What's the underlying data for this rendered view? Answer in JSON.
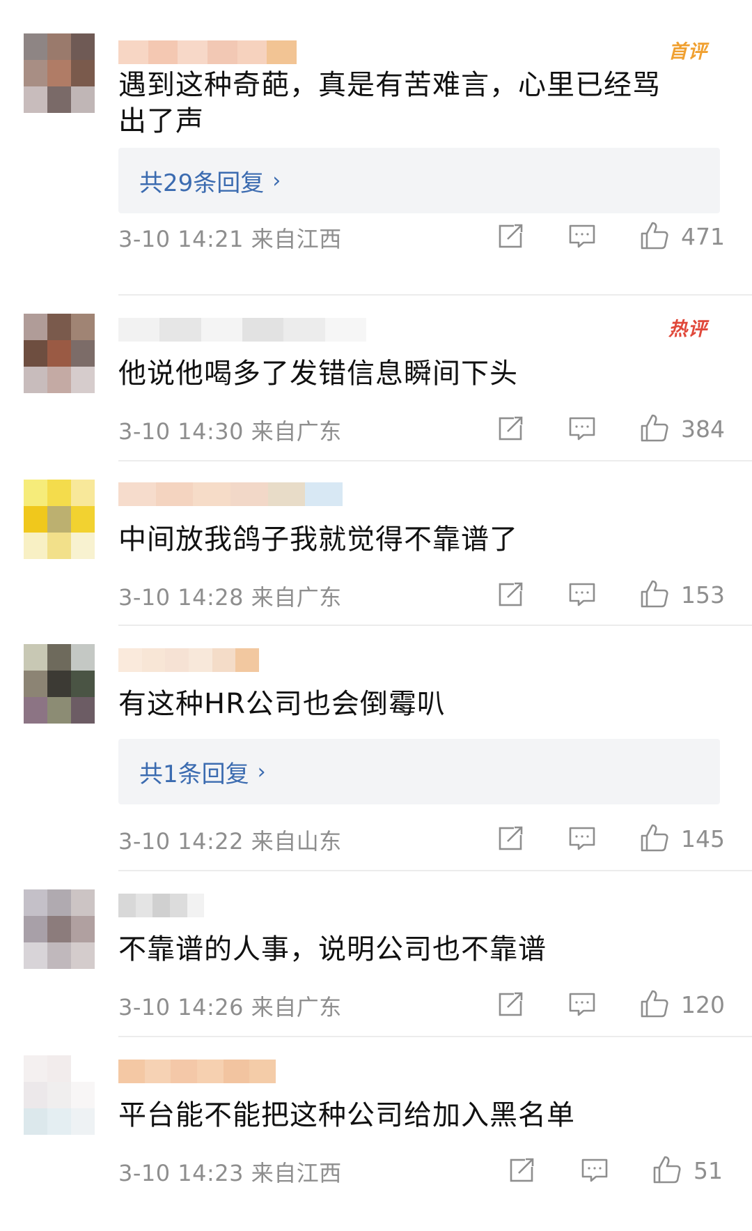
{
  "comments": [
    {
      "avatar_colors": [
        "#8e8584",
        "#9a7a6c",
        "#6f5a55",
        "#a88e84",
        "#b07c66",
        "#7a5a4c",
        "#c8bcbc",
        "#7a6a68",
        "#c0b6b6"
      ],
      "name_colors": [
        "#f7d6c4",
        "#f4c8b2",
        "#f7d8c8",
        "#f2c8b4",
        "#f6d2be",
        "#f2c494"
      ],
      "badge": "首评",
      "badge_type": "first",
      "text": "遇到这种奇葩，真是有苦难言，心里已经骂出了声",
      "reply_label": "共29条回复",
      "meta": "3-10 14:21  来自江西",
      "likes": "471"
    },
    {
      "avatar_colors": [
        "#b09c98",
        "#7a5a4c",
        "#a08474",
        "#6e4e40",
        "#9a5a44",
        "#7c6c68",
        "#c8bcbc",
        "#c4aaa4",
        "#d6cccc"
      ],
      "name_colors": [
        "#f2f2f2",
        "#e6e6e6",
        "#f4f4f4",
        "#e2e2e2",
        "#ececec",
        "#f6f6f6"
      ],
      "badge": "热评",
      "badge_type": "hot",
      "text": "他说他喝多了发错信息瞬间下头",
      "reply_label": "",
      "meta": "3-10 14:30  来自广东",
      "likes": "384"
    },
    {
      "avatar_colors": [
        "#f6ec7a",
        "#f4dc4c",
        "#f8e89a",
        "#f0c81c",
        "#bcb070",
        "#f2d230",
        "#f8f0c4",
        "#f2e08a",
        "#f8f2d0"
      ],
      "name_colors": [
        "#f6dccc",
        "#f4d4c0",
        "#f6dcc8",
        "#f2d8c8",
        "#e8dcc8",
        "#d8e8f4"
      ],
      "badge": "",
      "badge_type": "",
      "text": "中间放我鸽子我就觉得不靠谱了",
      "reply_label": "",
      "meta": "3-10 14:28  来自广东",
      "likes": "153"
    },
    {
      "avatar_colors": [
        "#c8c8b4",
        "#6e6a5c",
        "#c4c8c4",
        "#8c8474",
        "#3c3a34",
        "#4a5444",
        "#8c7484",
        "#8c8c74",
        "#6c5c64"
      ],
      "name_colors": [
        "#faeadc",
        "#f8e6d6",
        "#f6e2d4",
        "#f8e8da",
        "#f4dcc8",
        "#f2c8a0"
      ],
      "badge": "",
      "badge_type": "",
      "text": "有这种HR公司也会倒霉叭",
      "reply_label": "共1条回复",
      "meta": "3-10 14:22  来自山东",
      "likes": "145"
    },
    {
      "avatar_colors": [
        "#c4c0c8",
        "#b0aab0",
        "#ccc4c4",
        "#a8a0a8",
        "#8c7c7c",
        "#b0a0a0",
        "#d8d4d8",
        "#c0b8bc",
        "#d4cccc"
      ],
      "name_colors": [
        "#d8d8d8",
        "#e4e4e4",
        "#d0d0d0",
        "#dcdcdc",
        "#f2f2f2",
        "#ffffff"
      ],
      "badge": "",
      "badge_type": "",
      "text": "不靠谱的人事，说明公司也不靠谱",
      "reply_label": "",
      "meta": "3-10 14:26  来自广东",
      "likes": "120"
    },
    {
      "avatar_colors": [
        "#f4f0f0",
        "#f2ecec",
        "#ffffff",
        "#ece8ea",
        "#f0eeee",
        "#f8f6f6",
        "#dce8ec",
        "#e4eef2",
        "#eef2f4"
      ],
      "name_colors": [
        "#f4c8a4",
        "#f6d2b4",
        "#f4c8a8",
        "#f6d0b0",
        "#f2c4a0",
        "#f4cca8"
      ],
      "badge": "",
      "badge_type": "",
      "text": "平台能不能把这种公司给加入黑名单",
      "reply_label": "",
      "meta": "3-10 14:23  来自江西",
      "likes": "51"
    }
  ]
}
